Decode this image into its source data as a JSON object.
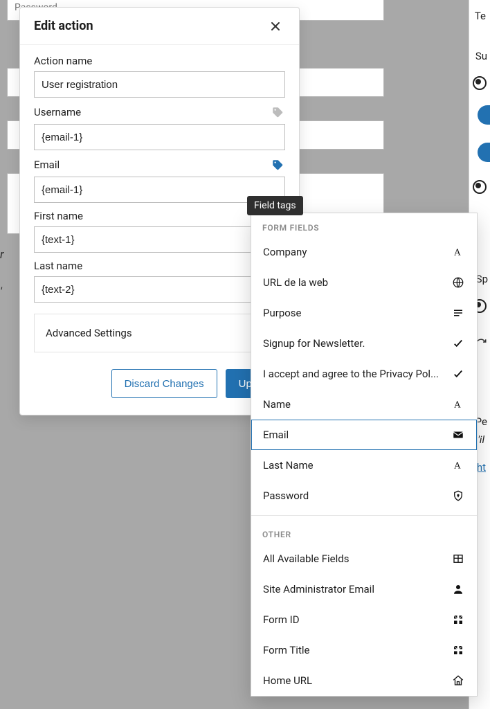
{
  "dialog": {
    "title": "Edit action",
    "fields": {
      "action_name": {
        "label": "Action name",
        "value": "User registration"
      },
      "username": {
        "label": "Username",
        "value": "{email-1}"
      },
      "email": {
        "label": "Email",
        "value": "{email-1}"
      },
      "first_name": {
        "label": "First name",
        "value": "{text-1}"
      },
      "last_name": {
        "label": "Last name",
        "value": "{text-2}"
      }
    },
    "advanced_label": "Advanced Settings",
    "buttons": {
      "discard": "Discard Changes",
      "update": "Update"
    }
  },
  "tooltip": {
    "label": "Field tags"
  },
  "dropdown": {
    "section_form_fields": "FORM FIELDS",
    "section_other": "OTHER",
    "items_form": [
      {
        "label": "Company",
        "icon": "text"
      },
      {
        "label": "URL de la web",
        "icon": "globe"
      },
      {
        "label": "Purpose",
        "icon": "lines"
      },
      {
        "label": "Signup for Newsletter.",
        "icon": "check"
      },
      {
        "label": "I accept and agree to the Privacy Pol...",
        "icon": "check"
      },
      {
        "label": "Name",
        "icon": "text"
      },
      {
        "label": "Email",
        "icon": "mail",
        "selected": true
      },
      {
        "label": "Last Name",
        "icon": "text"
      },
      {
        "label": "Password",
        "icon": "lock"
      }
    ],
    "items_other": [
      {
        "label": "All Available Fields",
        "icon": "table"
      },
      {
        "label": "Site Administrator Email",
        "icon": "user"
      },
      {
        "label": "Form ID",
        "icon": "grid"
      },
      {
        "label": "Form Title",
        "icon": "grid"
      },
      {
        "label": "Home URL",
        "icon": "home"
      }
    ]
  },
  "right_panel_fragments": {
    "t1": "Te",
    "t2": "Su",
    "t3": "Sp",
    "t4": "Pe",
    "t5": "'il",
    "link": "ht"
  },
  "left_crop": {
    "a": "r",
    "b": "'"
  },
  "bg_placeholder": "Password"
}
